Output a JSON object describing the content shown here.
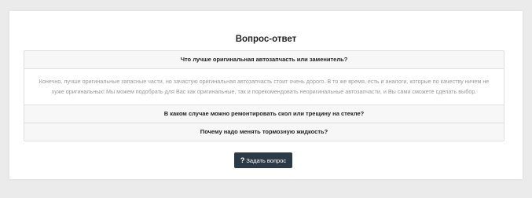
{
  "title": "Вопрос-ответ",
  "faq": [
    {
      "question": "Что лучше оригинальная автозапчасть или заменитель?",
      "answer": "Конечно, лучше оригинальные запасные части, но зачастую оригинальная автозапчасть стоит очень дорого. В то же время, есть и аналоги, которые по качеству ничем не хуже оригинальных! Мы можем подобрать для Вас как оригинальные, так и порекомендовать неоригинальные автозапчасти, и Вы сами сможете сделать выбор.",
      "expanded": true
    },
    {
      "question": "В каком случае можно ремонтировать скол или трещину на стекле?",
      "expanded": false
    },
    {
      "question": "Почему надо менять тормозную жидкость?",
      "expanded": false
    }
  ],
  "ask_button": {
    "icon": "question-icon",
    "icon_glyph": "?",
    "label": "Задать вопрос"
  },
  "colors": {
    "background": "#ebebeb",
    "card": "#ffffff",
    "button": "#2a3a46",
    "answer_text": "#9a9a9a"
  }
}
